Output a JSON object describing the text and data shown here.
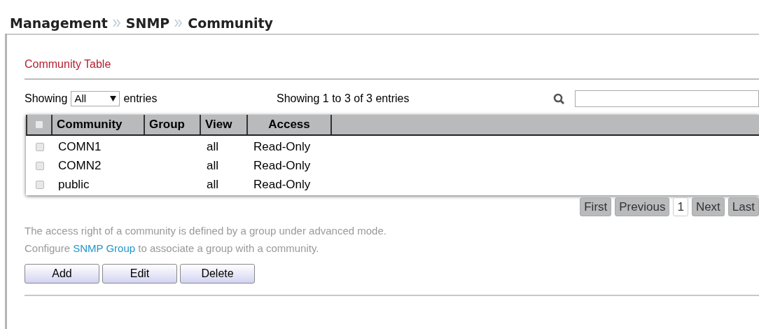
{
  "breadcrumb": [
    "Management",
    "SNMP",
    "Community"
  ],
  "section_title": "Community Table",
  "length_control": {
    "prefix": "Showing",
    "value": "All",
    "suffix": "entries"
  },
  "info": "Showing 1 to 3 of 3 entries",
  "table": {
    "select_all": {
      "checked": false
    },
    "columns": [
      "Community",
      "Group",
      "View",
      "Access"
    ],
    "rows": [
      {
        "checked": false,
        "cells": [
          "COMN1",
          "",
          "all",
          "Read-Only"
        ]
      },
      {
        "checked": false,
        "cells": [
          "COMN2",
          "",
          "all",
          "Read-Only"
        ]
      },
      {
        "checked": false,
        "cells": [
          "public",
          "",
          "all",
          "Read-Only"
        ]
      }
    ]
  },
  "pagination": [
    {
      "label": "First",
      "selected": false
    },
    {
      "label": "Previous",
      "selected": false
    },
    {
      "label": "1",
      "selected": true
    },
    {
      "label": "Next",
      "selected": false
    },
    {
      "label": "Last",
      "selected": false
    }
  ],
  "note": {
    "line1": "The access right of a community is defined by a group under advanced mode.",
    "line2_before": "Configure",
    "link": "SNMP Group",
    "line2_after": "to associate a group with a community."
  },
  "buttons": [
    "Add",
    "Edit",
    "Delete"
  ]
}
